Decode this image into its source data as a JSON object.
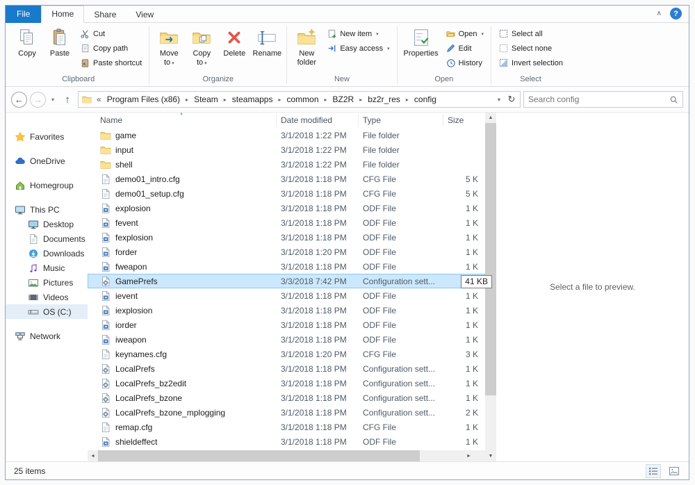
{
  "ribbon": {
    "tabs": [
      {
        "label": "File"
      },
      {
        "label": "Home"
      },
      {
        "label": "Share"
      },
      {
        "label": "View"
      }
    ],
    "clipboard": {
      "label": "Clipboard",
      "copy": "Copy",
      "paste": "Paste",
      "cut": "Cut",
      "copy_path": "Copy path",
      "paste_shortcut": "Paste shortcut"
    },
    "organize": {
      "label": "Organize",
      "move_to": "Move to",
      "copy_to": "Copy to",
      "delete": "Delete",
      "rename": "Rename"
    },
    "new_group": {
      "label": "New",
      "new_folder": "New folder",
      "new_item": "New item",
      "easy_access": "Easy access"
    },
    "open_group": {
      "label": "Open",
      "properties": "Properties",
      "open": "Open",
      "edit": "Edit",
      "history": "History"
    },
    "select_group": {
      "label": "Select",
      "select_all": "Select all",
      "select_none": "Select none",
      "invert_selection": "Invert selection"
    }
  },
  "address_bar": {
    "overflow": "«",
    "breadcrumbs": [
      "Program Files (x86)",
      "Steam",
      "steamapps",
      "common",
      "BZ2R",
      "bz2r_res",
      "config"
    ],
    "search_placeholder": "Search config"
  },
  "sidebar": {
    "items": [
      {
        "label": "Favorites",
        "icon": "star",
        "depth": 0
      },
      {
        "label": "OneDrive",
        "icon": "cloud",
        "depth": 0
      },
      {
        "label": "Homegroup",
        "icon": "homegroup",
        "depth": 0
      },
      {
        "label": "This PC",
        "icon": "pc",
        "depth": 0
      },
      {
        "label": "Desktop",
        "icon": "desktop",
        "depth": 1
      },
      {
        "label": "Documents",
        "icon": "documents",
        "depth": 1
      },
      {
        "label": "Downloads",
        "icon": "downloads",
        "depth": 1
      },
      {
        "label": "Music",
        "icon": "music",
        "depth": 1
      },
      {
        "label": "Pictures",
        "icon": "pictures",
        "depth": 1
      },
      {
        "label": "Videos",
        "icon": "videos",
        "depth": 1
      },
      {
        "label": "OS (C:)",
        "icon": "drive",
        "depth": 1,
        "selected": true
      },
      {
        "label": "Network",
        "icon": "network",
        "depth": 0
      }
    ]
  },
  "file_list": {
    "columns": {
      "name": "Name",
      "date": "Date modified",
      "type": "Type",
      "size": "Size"
    },
    "rows": [
      {
        "name": "game",
        "date": "3/1/2018 1:22 PM",
        "type": "File folder",
        "size": "",
        "icon": "folder"
      },
      {
        "name": "input",
        "date": "3/1/2018 1:22 PM",
        "type": "File folder",
        "size": "",
        "icon": "folder"
      },
      {
        "name": "shell",
        "date": "3/1/2018 1:22 PM",
        "type": "File folder",
        "size": "",
        "icon": "folder"
      },
      {
        "name": "demo01_intro.cfg",
        "date": "3/1/2018 1:18 PM",
        "type": "CFG File",
        "size": "5 K",
        "icon": "cfg"
      },
      {
        "name": "demo01_setup.cfg",
        "date": "3/1/2018 1:18 PM",
        "type": "CFG File",
        "size": "5 K",
        "icon": "cfg"
      },
      {
        "name": "explosion",
        "date": "3/1/2018 1:18 PM",
        "type": "ODF File",
        "size": "1 K",
        "icon": "odf"
      },
      {
        "name": "fevent",
        "date": "3/1/2018 1:18 PM",
        "type": "ODF File",
        "size": "1 K",
        "icon": "odf"
      },
      {
        "name": "fexplosion",
        "date": "3/1/2018 1:18 PM",
        "type": "ODF File",
        "size": "1 K",
        "icon": "odf"
      },
      {
        "name": "forder",
        "date": "3/1/2018 1:20 PM",
        "type": "ODF File",
        "size": "1 K",
        "icon": "odf"
      },
      {
        "name": "fweapon",
        "date": "3/1/2018 1:18 PM",
        "type": "ODF File",
        "size": "1 K",
        "icon": "odf"
      },
      {
        "name": "GamePrefs",
        "date": "3/3/2018 7:42 PM",
        "type": "Configuration sett...",
        "size": "41 KB",
        "icon": "config",
        "selected": true
      },
      {
        "name": "ievent",
        "date": "3/1/2018 1:18 PM",
        "type": "ODF File",
        "size": "1 K",
        "icon": "odf"
      },
      {
        "name": "iexplosion",
        "date": "3/1/2018 1:18 PM",
        "type": "ODF File",
        "size": "1 K",
        "icon": "odf"
      },
      {
        "name": "iorder",
        "date": "3/1/2018 1:18 PM",
        "type": "ODF File",
        "size": "1 K",
        "icon": "odf"
      },
      {
        "name": "iweapon",
        "date": "3/1/2018 1:18 PM",
        "type": "ODF File",
        "size": "1 K",
        "icon": "odf"
      },
      {
        "name": "keynames.cfg",
        "date": "3/1/2018 1:20 PM",
        "type": "CFG File",
        "size": "3 K",
        "icon": "cfg"
      },
      {
        "name": "LocalPrefs",
        "date": "3/1/2018 1:18 PM",
        "type": "Configuration sett...",
        "size": "1 K",
        "icon": "config"
      },
      {
        "name": "LocalPrefs_bz2edit",
        "date": "3/1/2018 1:18 PM",
        "type": "Configuration sett...",
        "size": "1 K",
        "icon": "config"
      },
      {
        "name": "LocalPrefs_bzone",
        "date": "3/1/2018 1:18 PM",
        "type": "Configuration sett...",
        "size": "1 K",
        "icon": "config"
      },
      {
        "name": "LocalPrefs_bzone_mplogging",
        "date": "3/1/2018 1:18 PM",
        "type": "Configuration sett...",
        "size": "2 K",
        "icon": "config"
      },
      {
        "name": "remap.cfg",
        "date": "3/1/2018 1:18 PM",
        "type": "CFG File",
        "size": "1 K",
        "icon": "cfg"
      },
      {
        "name": "shieldeffect",
        "date": "3/1/2018 1:18 PM",
        "type": "ODF File",
        "size": "1 K",
        "icon": "odf"
      }
    ]
  },
  "preview_pane": {
    "message": "Select a file to preview."
  },
  "status_bar": {
    "items_count": "25 items"
  },
  "icons": {
    "back": "←",
    "forward": "→",
    "up": "↑",
    "dropdown": "▾",
    "refresh": "↻",
    "collapse": "∧",
    "help": "?",
    "crumb_sep": "▸",
    "scroll_up": "▲",
    "scroll_down": "▼",
    "scroll_left": "◄",
    "scroll_right": "►",
    "sort_asc": "▲"
  },
  "colors": {
    "accent": "#1979ca",
    "selection_fill": "#cce8ff",
    "selection_border": "#8fc6f0",
    "file_tab": "#1979ca"
  }
}
